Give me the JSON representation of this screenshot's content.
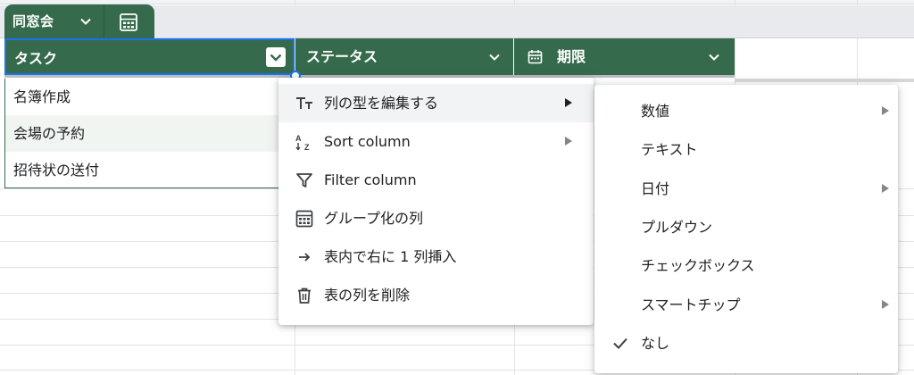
{
  "table": {
    "name": "同窓会",
    "columns": [
      {
        "label": "タスク"
      },
      {
        "label": "ステータス"
      },
      {
        "label": "期限"
      }
    ],
    "rows": [
      "名簿作成",
      "会場の予約",
      "招待状の送付"
    ]
  },
  "context_menu": {
    "items": [
      {
        "icon": "text-type-icon",
        "label": "列の型を編集する",
        "has_submenu": true
      },
      {
        "icon": "sort-az-icon",
        "label": "Sort column",
        "has_submenu": true
      },
      {
        "icon": "filter-icon",
        "label": "Filter column",
        "has_submenu": false
      },
      {
        "icon": "group-table-icon",
        "label": "グループ化の列",
        "has_submenu": false
      },
      {
        "icon": "arrow-right-icon",
        "label": "表内で右に 1 列挿入",
        "has_submenu": false
      },
      {
        "icon": "trash-icon",
        "label": "表の列を削除",
        "has_submenu": false
      }
    ]
  },
  "type_submenu": {
    "items": [
      {
        "label": "数値",
        "has_submenu": true,
        "checked": false
      },
      {
        "label": "テキスト",
        "has_submenu": false,
        "checked": false
      },
      {
        "label": "日付",
        "has_submenu": true,
        "checked": false
      },
      {
        "label": "プルダウン",
        "has_submenu": false,
        "checked": false
      },
      {
        "label": "チェックボックス",
        "has_submenu": false,
        "checked": false
      },
      {
        "label": "スマートチップ",
        "has_submenu": true,
        "checked": false
      },
      {
        "label": "なし",
        "has_submenu": false,
        "checked": true
      }
    ]
  },
  "colors": {
    "table_header": "#356b4c",
    "selection": "#1a73e8",
    "alt_row": "#f1f5f2"
  }
}
